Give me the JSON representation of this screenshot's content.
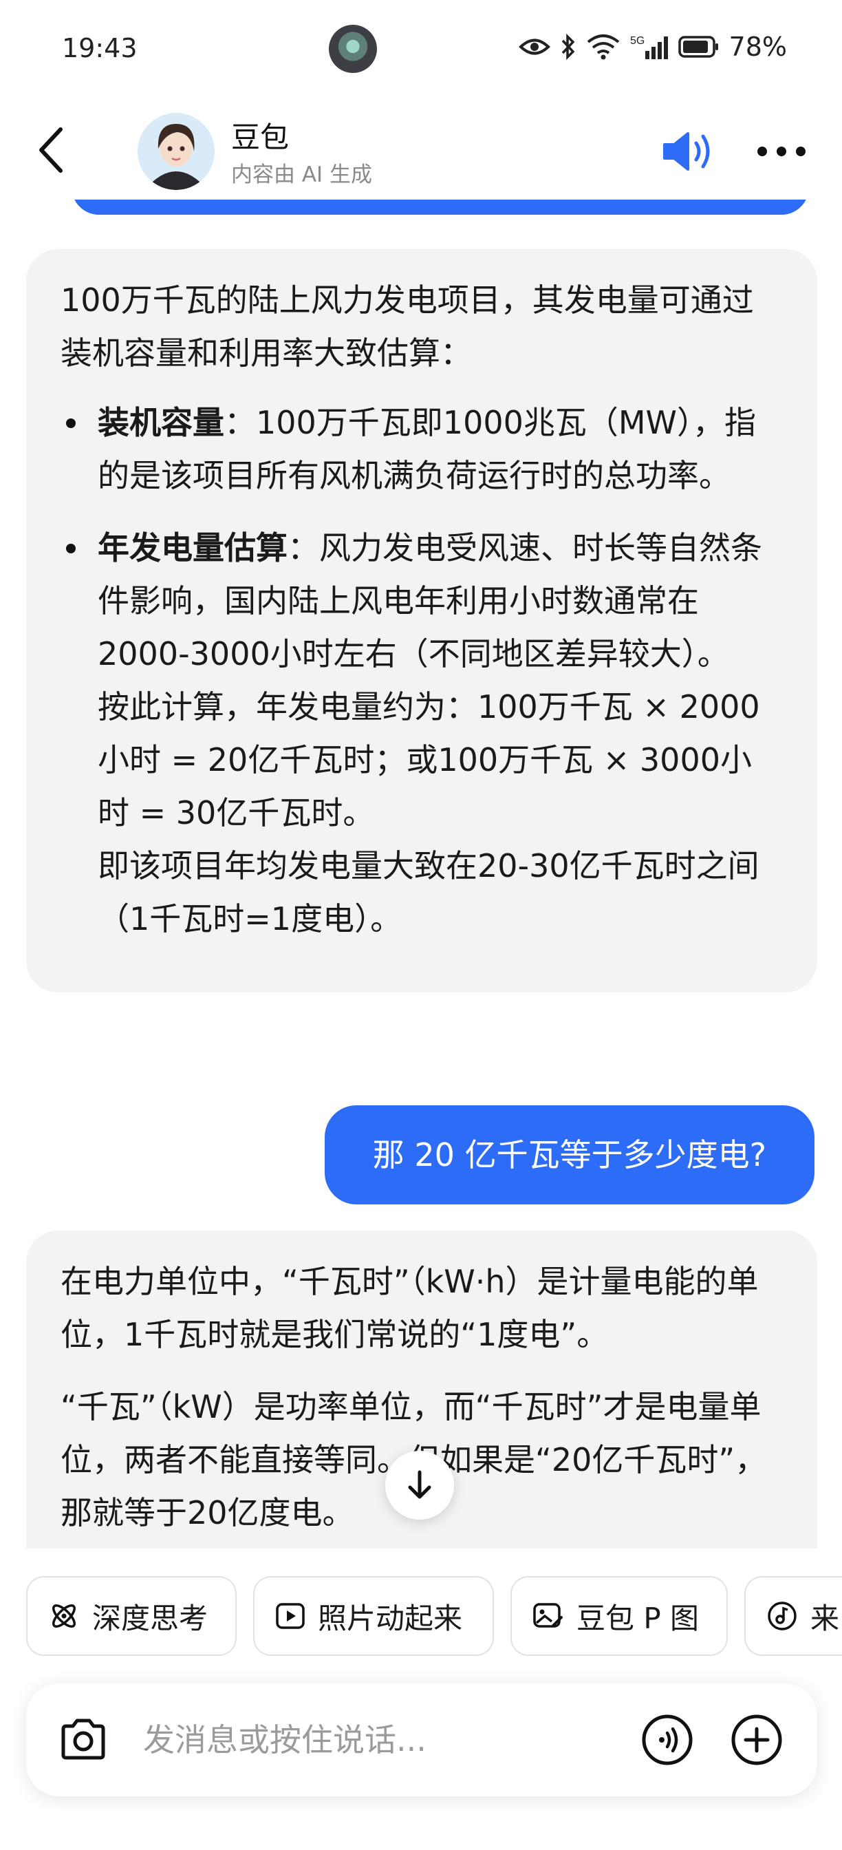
{
  "status_bar": {
    "time": "19:43",
    "signal_label": "5G",
    "battery": "78%"
  },
  "header": {
    "title": "豆包",
    "subtitle": "内容由 AI 生成"
  },
  "messages": {
    "bot1": {
      "intro": "100万千瓦的陆上风力发电项目，其发电量可通过装机容量和利用率大致估算：",
      "bullet1_title": "装机容量",
      "bullet1_text": "：100万千瓦即1000兆瓦（MW），指的是该项目所有风机满负荷运行时的总功率。",
      "bullet2_title": "年发电量估算",
      "bullet2_text": "：风力发电受风速、时长等自然条件影响，国内陆上风电年利用小时数通常在2000-3000小时左右（不同地区差异较大）。",
      "bullet2_line2": "按此计算，年发电量约为：100万千瓦 × 2000小时 = 20亿千瓦时；或100万千瓦 × 3000小时 = 30亿千瓦时。",
      "bullet2_line3": "即该项目年均发电量大致在20-30亿千瓦时之间（1千瓦时=1度电）。"
    },
    "user1": "那 20 亿千瓦等于多少度电?",
    "bot2": {
      "para1": "在电力单位中，“千瓦时”（kW·h）是计量电能的单位，1千瓦时就是我们常说的“1度电”。",
      "para2": "“千瓦”（kW）是功率单位，而“千瓦时”才是电量单位，两者不能直接等同。但如果是“20亿千瓦时”，那就等于20亿度电。"
    }
  },
  "chips": [
    {
      "label": "深度思考",
      "icon": "atom-icon"
    },
    {
      "label": "照片动起来",
      "icon": "play-icon"
    },
    {
      "label": "豆包 P 图",
      "icon": "image-edit-icon"
    },
    {
      "label": "来",
      "icon": "music-icon"
    }
  ],
  "input": {
    "placeholder": "发消息或按住说话..."
  },
  "colors": {
    "accent": "#2C6CF6",
    "bubble_bg": "#F3F3F3"
  }
}
